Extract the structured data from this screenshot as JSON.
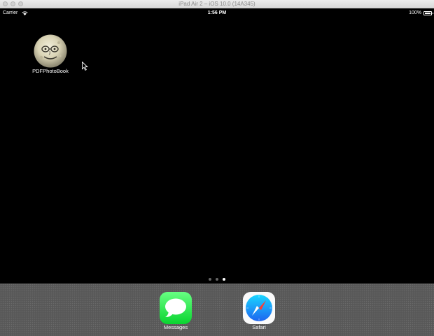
{
  "window": {
    "title": "iPad Air 2 – iOS 10.0 (14A345)"
  },
  "status_bar": {
    "carrier": "Carrier",
    "time": "1:56 PM",
    "battery_percent": "100%",
    "wifi_icon": "wifi-icon",
    "battery_icon": "battery-icon"
  },
  "home_screen": {
    "apps": [
      {
        "label": "PDFPhotoBook",
        "icon": "moon-face-icon"
      }
    ],
    "page_count": 3,
    "current_page": 3
  },
  "dock": {
    "apps": [
      {
        "label": "Messages",
        "icon": "messages-icon",
        "color": "#4cd964"
      },
      {
        "label": "Safari",
        "icon": "safari-compass-icon",
        "color": "#1e90ff"
      }
    ]
  },
  "colors": {
    "background": "#000000",
    "dock": "#5b5b5b",
    "active_dot": "#ffffff",
    "inactive_dot": "#666666"
  }
}
